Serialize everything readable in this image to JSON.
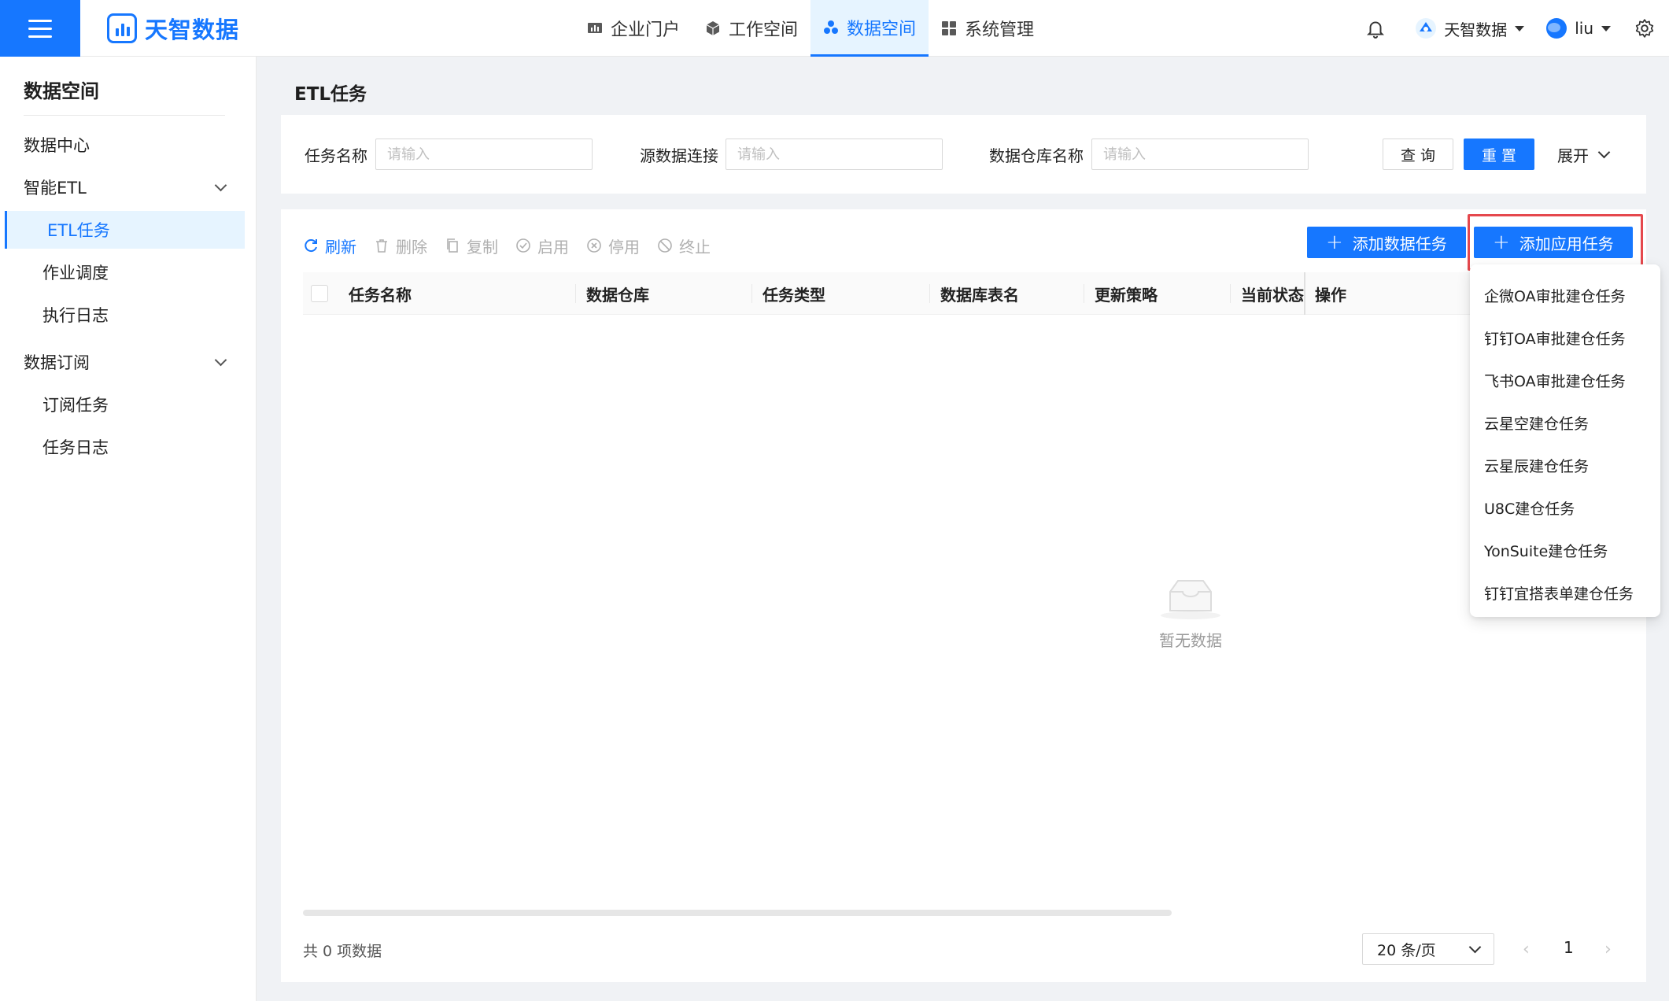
{
  "brand": {
    "name": "天智数据"
  },
  "nav": {
    "items": [
      {
        "label": "企业门户",
        "icon": "chart-icon"
      },
      {
        "label": "工作空间",
        "icon": "cube-icon"
      },
      {
        "label": "数据空间",
        "icon": "cluster-icon",
        "active": true
      },
      {
        "label": "系统管理",
        "icon": "grid-icon"
      }
    ]
  },
  "header": {
    "tenant": "天智数据",
    "user": "liu"
  },
  "sidebar": {
    "title": "数据空间",
    "items": [
      {
        "label": "数据中心"
      },
      {
        "label": "智能ETL"
      },
      {
        "label": "ETL任务"
      },
      {
        "label": "作业调度"
      },
      {
        "label": "执行日志"
      },
      {
        "label": "数据订阅"
      },
      {
        "label": "订阅任务"
      },
      {
        "label": "任务日志"
      }
    ]
  },
  "page": {
    "title": "ETL任务"
  },
  "filters": {
    "task_name_label": "任务名称",
    "source_label": "源数据连接",
    "warehouse_label": "数据仓库名称",
    "placeholder": "请输入",
    "query_label": "查 询",
    "reset_label": "重 置",
    "expand_label": "展开"
  },
  "toolbar": {
    "refresh": "刷新",
    "delete": "删除",
    "copy": "复制",
    "enable": "启用",
    "disable": "停用",
    "stop": "终止",
    "add_data_task": "添加数据任务",
    "add_app_task": "添加应用任务"
  },
  "table": {
    "columns": [
      "任务名称",
      "数据仓库",
      "任务类型",
      "数据库表名",
      "更新策略",
      "当前状态",
      "操作"
    ],
    "empty_text": "暂无数据"
  },
  "pagination": {
    "total_text": "共 0 项数据",
    "page_size": "20 条/页",
    "current_page": "1"
  },
  "dropdown": {
    "items": [
      "企微OA审批建仓任务",
      "钉钉OA审批建仓任务",
      "飞书OA审批建仓任务",
      "云星空建仓任务",
      "云星辰建仓任务",
      "U8C建仓任务",
      "YonSuite建仓任务",
      "钉钉宜搭表单建仓任务"
    ]
  },
  "colors": {
    "primary": "#1677ff",
    "highlight": "#e5484d"
  }
}
